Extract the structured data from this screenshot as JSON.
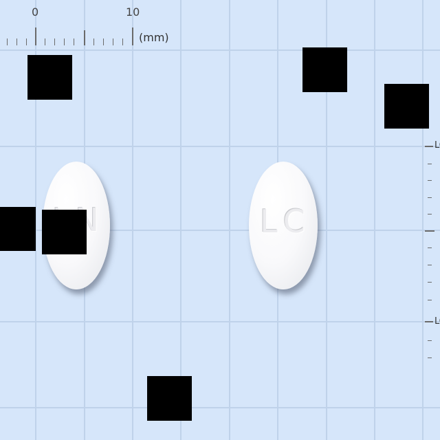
{
  "ruler": {
    "top_labels": [
      "0",
      "10"
    ],
    "unit": "(mm)",
    "right_labels": [
      "LO",
      "LO"
    ]
  },
  "tablets": [
    {
      "name": "left-tablet",
      "imprint": "LN"
    },
    {
      "name": "right-tablet",
      "imprint": "LC"
    }
  ]
}
